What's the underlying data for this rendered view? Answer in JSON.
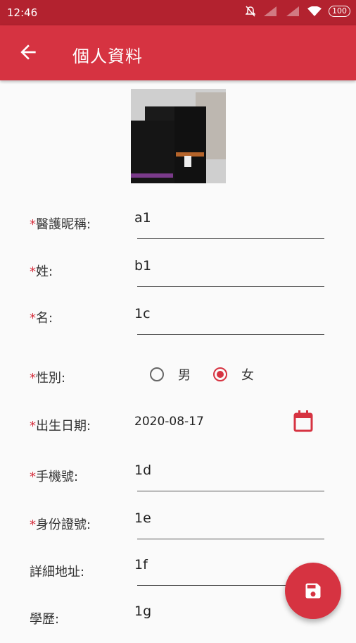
{
  "status_bar": {
    "time": "12:46",
    "battery": "100"
  },
  "app_bar": {
    "title": "個人資料",
    "back_icon": "arrow-back-icon"
  },
  "profile_photo": {
    "description": "photo"
  },
  "form": {
    "nickname": {
      "required_mark": "*",
      "label": "醫護昵稱:",
      "value": "a1"
    },
    "surname": {
      "required_mark": "*",
      "label": "姓:",
      "value": "b1"
    },
    "given_name": {
      "required_mark": "*",
      "label": "名:",
      "value": "1c"
    },
    "gender": {
      "required_mark": "*",
      "label": "性別:",
      "options": [
        "男",
        "女"
      ],
      "selected": "女"
    },
    "birth_date": {
      "required_mark": "*",
      "label": "出生日期:",
      "value": "2020-08-17",
      "icon": "calendar-icon"
    },
    "mobile": {
      "required_mark": "*",
      "label": "手機號:",
      "value": "1d"
    },
    "id_number": {
      "required_mark": "*",
      "label": "身份證號:",
      "value": "1e"
    },
    "address": {
      "label": "詳細地址:",
      "value": "1f"
    },
    "education": {
      "label": "學歷:",
      "value": "1g"
    }
  },
  "fab": {
    "icon": "save-icon"
  },
  "colors": {
    "primary": "#d63341",
    "status_bar": "#b3222f"
  }
}
